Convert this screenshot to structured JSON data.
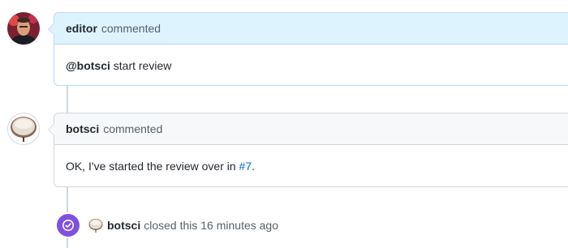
{
  "comments": [
    {
      "author": "editor",
      "action": "commented",
      "body_mention": "@botsci",
      "body_text": " start review",
      "accent_color": "#ddf4ff"
    },
    {
      "author": "botsci",
      "action": "commented",
      "body_prefix": "OK, I've started the review over in ",
      "body_link": "#7",
      "body_suffix": ".",
      "accent_color": "#f6f8fa"
    }
  ],
  "event": {
    "icon": "check-circle-icon",
    "author": "botsci",
    "text": "closed this 16 minutes ago",
    "badge_color": "#8250df"
  },
  "colors": {
    "link": "#0969da",
    "border": "#d0d7de",
    "editor_border": "#b6d9f4"
  }
}
